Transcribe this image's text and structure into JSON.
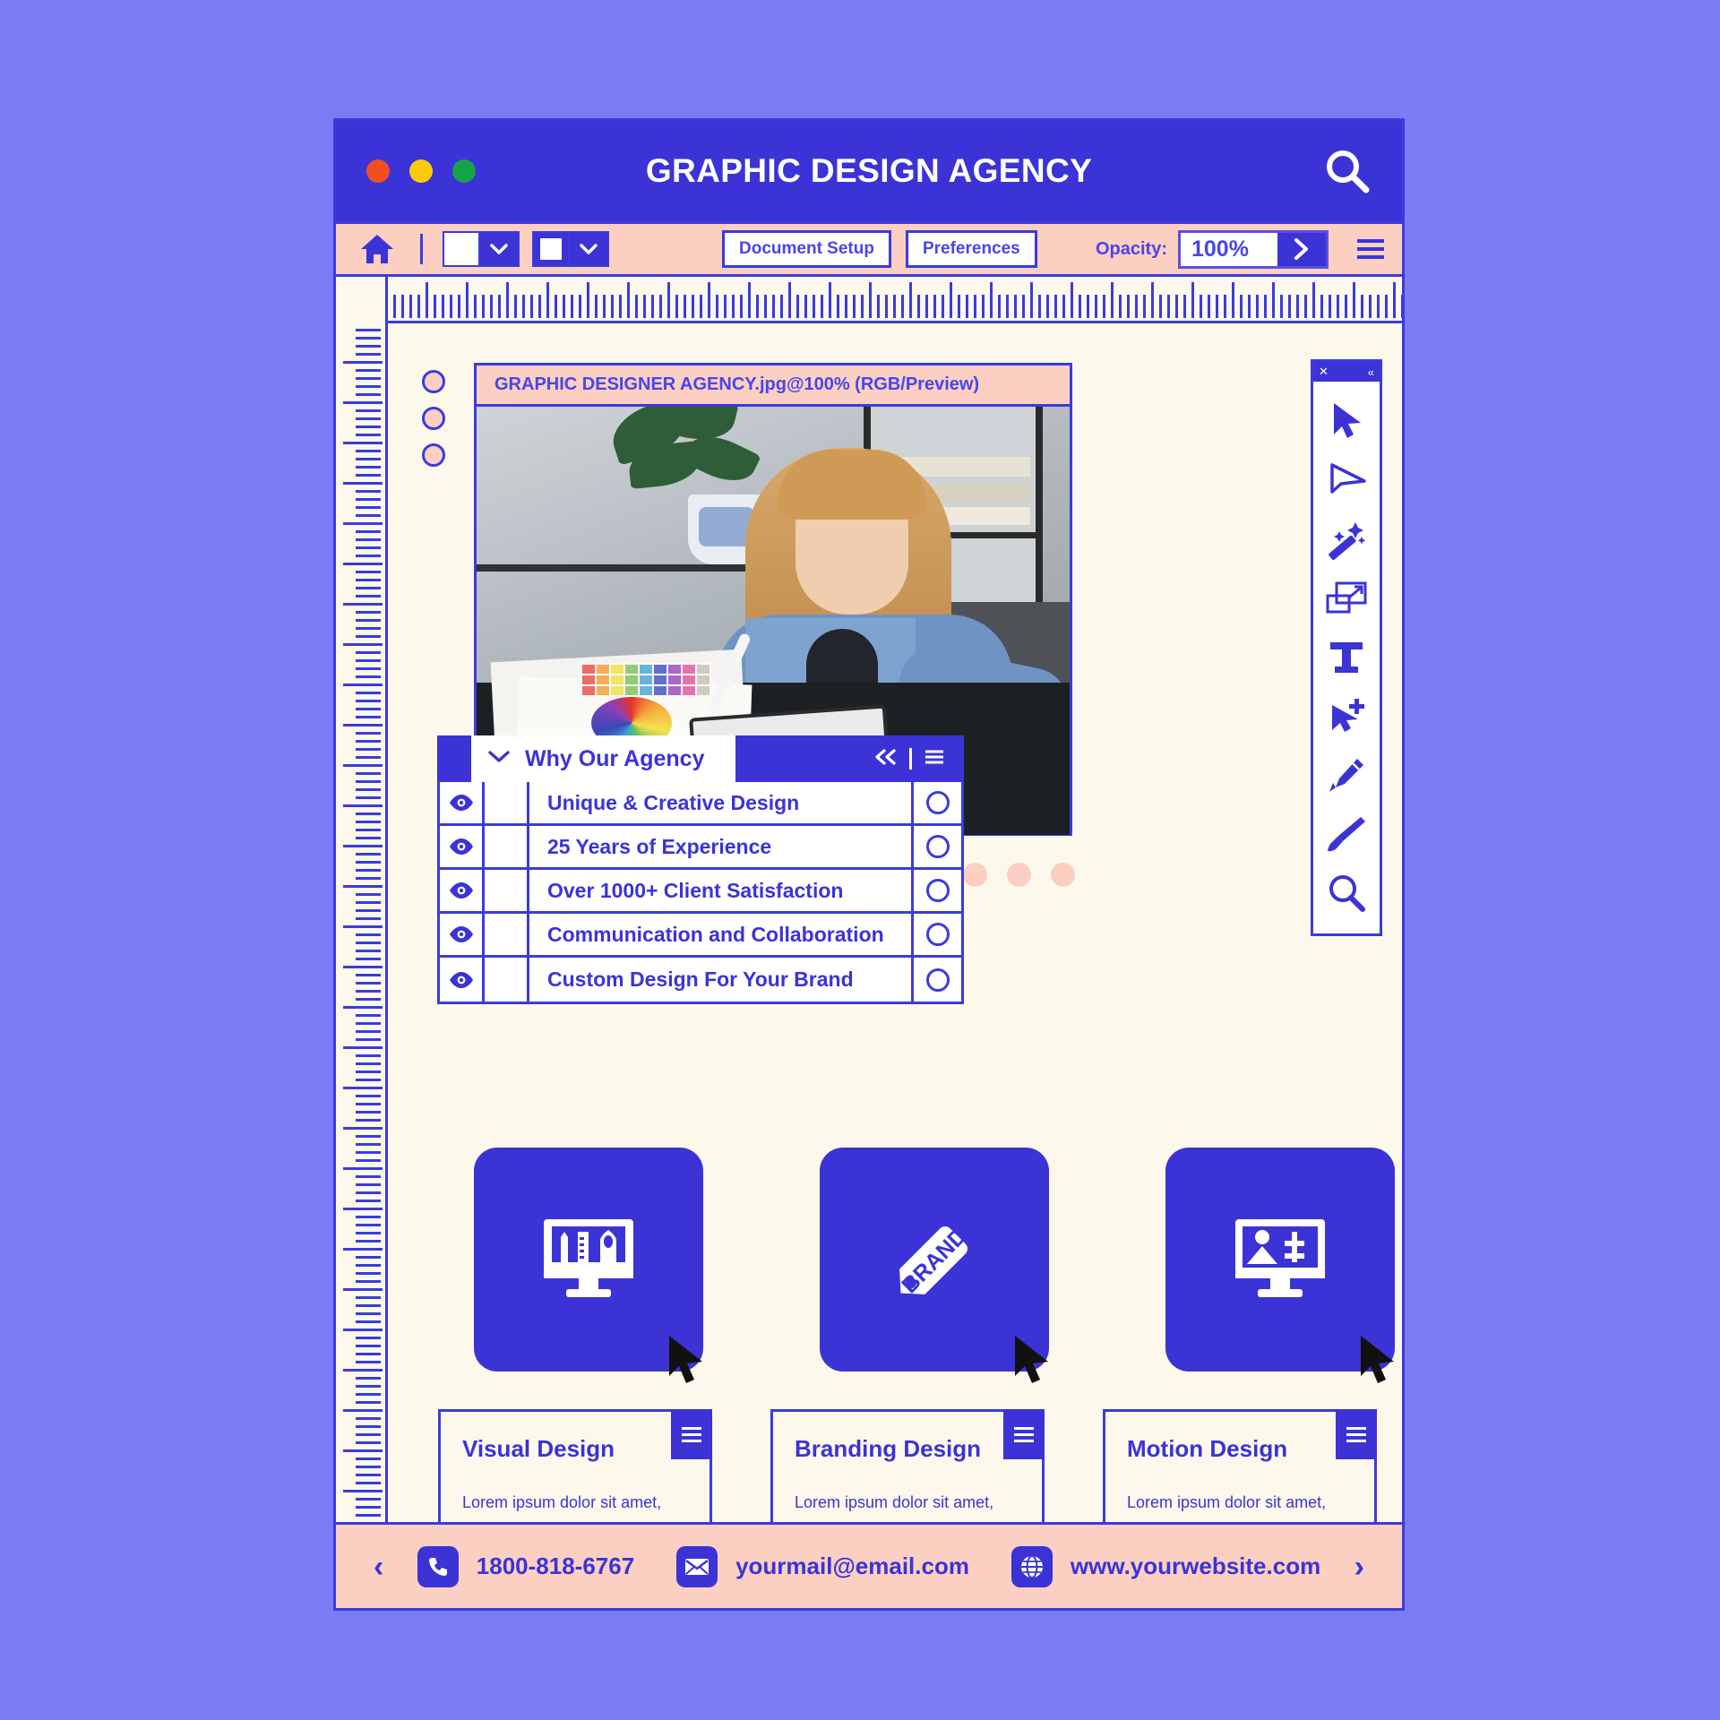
{
  "theme": {
    "page_bg": "#7b7bf5",
    "primary": "#3b33d6",
    "accent_peach": "#fbcfc2",
    "canvas_bg": "#fdf8ec",
    "text_blue": "#4a45e8"
  },
  "titlebar": {
    "title": "GRAPHIC DESIGN AGENCY",
    "dots": [
      "red",
      "yellow",
      "green"
    ],
    "search_icon": "search-icon"
  },
  "toolbar": {
    "home_icon": "home-icon",
    "fill_swatch": "fill-color-swatch",
    "stroke_swatch": "stroke-color-swatch",
    "document_setup_label": "Document Setup",
    "preferences_label": "Preferences",
    "opacity_label": "Opacity:",
    "opacity_value": "100%",
    "opacity_placeholder": "100%",
    "go_icon": "chevron-right-icon",
    "menu_icon": "hamburger-menu-icon"
  },
  "image_card": {
    "title": "GRAPHIC DESIGNER AGENCY.jpg@100% (RGB/Preview)",
    "photo_alt": "designer-at-desk-photo"
  },
  "agency_panel": {
    "title": "Why Our Agency",
    "collapse_icon": "chevron-down-icon",
    "prev_icon": "double-chevron-left-icon",
    "menu_icon": "hamburger-menu-icon",
    "items": [
      {
        "label": "Unique & Creative Design",
        "visible_icon": "eye-icon",
        "toggle": "radio-circle"
      },
      {
        "label": "25 Years of Experience",
        "visible_icon": "eye-icon",
        "toggle": "radio-circle"
      },
      {
        "label": "Over 1000+ Client Satisfaction",
        "visible_icon": "eye-icon",
        "toggle": "radio-circle"
      },
      {
        "label": "Communication and Collaboration",
        "visible_icon": "eye-icon",
        "toggle": "radio-circle"
      },
      {
        "label": "Custom Design For Your Brand",
        "visible_icon": "eye-icon",
        "toggle": "radio-circle"
      }
    ]
  },
  "tools_palette": {
    "close_icon": "close-icon",
    "collapse_icon": "double-chevron-left-icon",
    "tools": [
      {
        "name": "move-tool-icon"
      },
      {
        "name": "direct-selection-tool-icon"
      },
      {
        "name": "magic-wand-tool-icon"
      },
      {
        "name": "transform-scale-tool-icon"
      },
      {
        "name": "type-tool-icon"
      },
      {
        "name": "add-anchor-point-tool-icon"
      },
      {
        "name": "pen-tool-icon"
      },
      {
        "name": "paintbrush-tool-icon"
      },
      {
        "name": "zoom-tool-icon"
      }
    ]
  },
  "carousel": {
    "dot_count": 3,
    "dot_color": "#fbcfc2"
  },
  "side_markers": {
    "count": 3,
    "color": "#fbcfc2"
  },
  "services": [
    {
      "icon": "design-monitor-tools-icon",
      "cursor": "mouse-pointer-icon"
    },
    {
      "icon": "brand-tag-icon",
      "label_on_icon": "BRAND",
      "cursor": "mouse-pointer-icon"
    },
    {
      "icon": "motion-monitor-sliders-icon",
      "cursor": "mouse-pointer-icon"
    }
  ],
  "cards": [
    {
      "title": "Visual Design",
      "body": "Lorem ipsum dolor sit amet, consectetuer adipiscing elit, sed diam nonummy nibh euismod tincidunt.",
      "menu_icon": "hamburger-menu-icon"
    },
    {
      "title": "Branding Design",
      "body": "Lorem ipsum dolor sit amet, consectetuer adipiscing elit, sed diam nonummy nibh euismod tincidunt.",
      "menu_icon": "hamburger-menu-icon"
    },
    {
      "title": "Motion Design",
      "body": "Lorem ipsum dolor sit amet, consectetuer adipiscing elit, sed diam nonummy nibh euismod tincidunt.",
      "menu_icon": "hamburger-menu-icon"
    }
  ],
  "footer": {
    "prev_label": "‹",
    "next_label": "›",
    "items": [
      {
        "icon": "phone-icon",
        "text": "1800-818-6767"
      },
      {
        "icon": "envelope-icon",
        "text": "yourmail@email.com"
      },
      {
        "icon": "globe-icon",
        "text": "www.yourwebsite.com"
      }
    ]
  }
}
